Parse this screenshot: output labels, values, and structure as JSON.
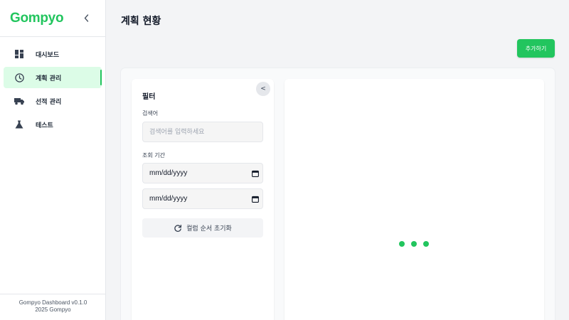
{
  "app": {
    "logo_text": "Gompyo",
    "brand_color": "#22c55e",
    "footer_version": "Gompyo Dashboard v0.1.0",
    "footer_copyright": "2025 Gompyo"
  },
  "sidebar": {
    "collapse_icon": "chevron-left-icon",
    "items": [
      {
        "label": "대시보드",
        "icon": "dashboard-icon",
        "active": false
      },
      {
        "label": "계획 관리",
        "icon": "clock-icon",
        "active": true
      },
      {
        "label": "선적 관리",
        "icon": "truck-icon",
        "active": false
      },
      {
        "label": "테스트",
        "icon": "flask-icon",
        "active": false
      }
    ]
  },
  "header": {
    "title": "계획 현황",
    "add_button_label": "추가하기"
  },
  "filter": {
    "title": "필터",
    "toggle_label": "<",
    "search_label": "검색어",
    "search_placeholder": "검색어를 입력하세요",
    "search_value": "",
    "period_label": "조회 기간",
    "start_date": "mm/dd/yyyy",
    "end_date": "mm/dd/yyyy",
    "reset_label": "컬럼 순서 초기화"
  },
  "main": {
    "loading_indicator": "three-dot-loader",
    "loading_color": "#22c55e"
  }
}
